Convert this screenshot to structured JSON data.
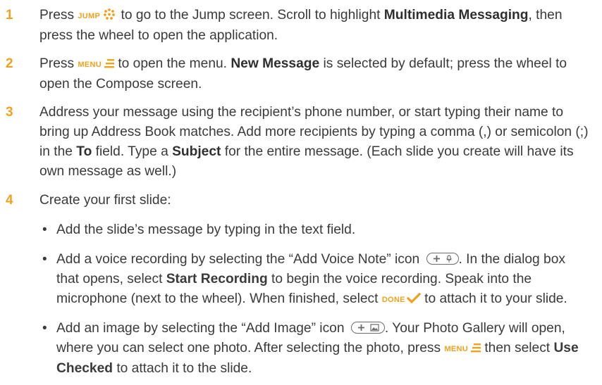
{
  "colors": {
    "accent": "#f0a21d",
    "text": "#3a3a3a"
  },
  "icons": {
    "jump": "jump-key-icon",
    "menu": "menu-key-icon",
    "done": "done-check-icon",
    "voice": "add-voice-note-icon",
    "image": "add-image-icon"
  },
  "keys": {
    "jump": "JUMP",
    "menu": "MENU",
    "done": "DONE"
  },
  "steps": [
    {
      "num": "1",
      "p1": "Press ",
      "p2": " to go to the Jump screen. Scroll to highlight ",
      "b1": "Multimedia Messaging",
      "p3": ", then press the wheel to open the application."
    },
    {
      "num": "2",
      "p1": "Press ",
      "p2": " to open the menu. ",
      "b1": "New Message",
      "p3": " is selected by default; press the wheel to open the Compose screen."
    },
    {
      "num": "3",
      "p1": "Address your message using the recipient’s phone number, or start typing their name to bring up Address Book matches. Add more recipients by typing a comma (,) or semicolon (;) in the ",
      "b1": "To",
      "p2": " field. Type a ",
      "b2": "Subject",
      "p3": " for the entire message. (Each slide you create will have its own message as well.)"
    },
    {
      "num": "4",
      "p1": "Create your first slide:"
    }
  ],
  "bullets": [
    {
      "dot": "•",
      "p1": "Add the slide’s message by typing in the text field."
    },
    {
      "dot": "•",
      "p1": "Add a voice recording by selecting the “Add Voice Note” icon ",
      "p2": ". In the dialog box that opens, select ",
      "b1": "Start Recording",
      "p3": " to begin the voice recording. Speak into the microphone (next to the wheel). When finished, select ",
      "p4": " to attach it to your slide."
    },
    {
      "dot": "•",
      "p1": "Add an image by selecting the “Add Image” icon ",
      "p2": ". Your Photo Gallery will open, where you can select one photo. After selecting the photo, press ",
      "p3": " then select ",
      "b1": "Use Checked",
      "p4": " to attach it to the slide."
    }
  ]
}
